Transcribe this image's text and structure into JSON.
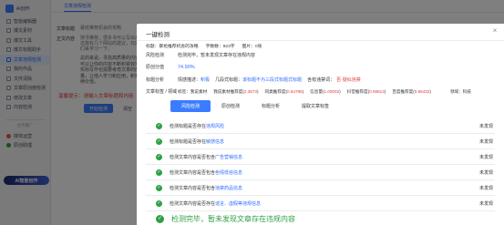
{
  "sidebar": {
    "logo_text": "AI创作",
    "items": [
      {
        "label": "智能编辑器",
        "active": false
      },
      {
        "label": "爆文素材",
        "active": false
      },
      {
        "label": "爆文工具",
        "active": false
      },
      {
        "label": "爆文标题助手",
        "active": false
      },
      {
        "label": "文章违规检测",
        "active": true
      },
      {
        "label": "我的作品",
        "active": false
      },
      {
        "label": "文件清除",
        "active": false
      },
      {
        "label": "文章原创度检测",
        "active": false
      },
      {
        "label": "修改文章",
        "active": false
      },
      {
        "label": "内容检测",
        "active": false
      }
    ],
    "section_label": "合作推广",
    "extensions": [
      {
        "label": "媒体运营",
        "color": "#e05a3a"
      },
      {
        "label": "原创助理",
        "color": "#2ea043"
      }
    ],
    "ai_badge": "AI智能创作"
  },
  "background": {
    "tab_label": "文章违规检测",
    "title_label": "文章标题",
    "title_value": "暴抢推荐机会的攻略",
    "content_label": "正文内容",
    "snippet": "搜寻推荐，很多书可以写出来的这篇有几个网站的建议，日后我们来学习一下。",
    "body_text": "总的来说，寻找高质量的内容，可以让你的内容不断积累效果，实际写作也需要考虑文章的质量，让他人学习和应用，积累持续价值。",
    "warning": "温馨提示：请输入文章标题和内容",
    "primary_button": "开始检测",
    "secondary_button": "清空"
  },
  "modal": {
    "title": "一键检测",
    "meta": {
      "title_label": "标题：暴抢推荐机会的攻略",
      "word_count": "字数数：923字",
      "image_count": "图片：0张"
    },
    "risk_label": "风险检测",
    "risk_value": "检测完毕，暂未发现文章存在违规内容",
    "originality_label": "原创分值",
    "originality_value": "74.90%",
    "title_analysis_label": "标题分析",
    "title_analysis": {
      "emotion_prefix": "情感描述：",
      "emotion_value": "积极",
      "pattern_label": "几段式标题：",
      "pattern_value": "该标题不为三段式标题式标题",
      "keyword_label": "含有违禁词：",
      "keyword_value": "否·疑似违禁"
    },
    "stats_label": "文章标签 / 领域",
    "stats": [
      {
        "label": "标签：",
        "value": "我说素材"
      },
      {
        "label": "我说素材推荐度",
        "value": "2.3873"
      },
      {
        "label": "同类推荐度",
        "value": "0.64785"
      },
      {
        "label": "信息量",
        "value": "1.00002"
      },
      {
        "label": "抖音推荐度",
        "value": "0.59613"
      },
      {
        "label": "百度推荐度",
        "value": "0.66432"
      }
    ],
    "stats_domain": "领域：科技",
    "tabs": [
      "风险检测",
      "原创检测",
      "标题分析",
      "提取文章标签"
    ],
    "active_tab": 0,
    "results": [
      {
        "prefix": "检测标题是否存在",
        "highlight": "违规风险",
        "status": "未发现"
      },
      {
        "prefix": "检测标题是否存在",
        "highlight": "敏感信息",
        "status": "未发现"
      },
      {
        "prefix": "检测文章内容是否包含",
        "highlight": "广告营销信息",
        "status": "未发现"
      },
      {
        "prefix": "检测文章内容是否包含",
        "highlight": "色情低俗信息",
        "status": "未发现"
      },
      {
        "prefix": "检测文章内容是否包含",
        "highlight": "违禁药品信息",
        "status": "未发现"
      },
      {
        "prefix": "检测文章内容是否存在",
        "highlight": "谣言、虚假等违规信息",
        "status": "未发现"
      }
    ],
    "final_message": "检测完毕，暂未发现文章存在违规内容"
  }
}
